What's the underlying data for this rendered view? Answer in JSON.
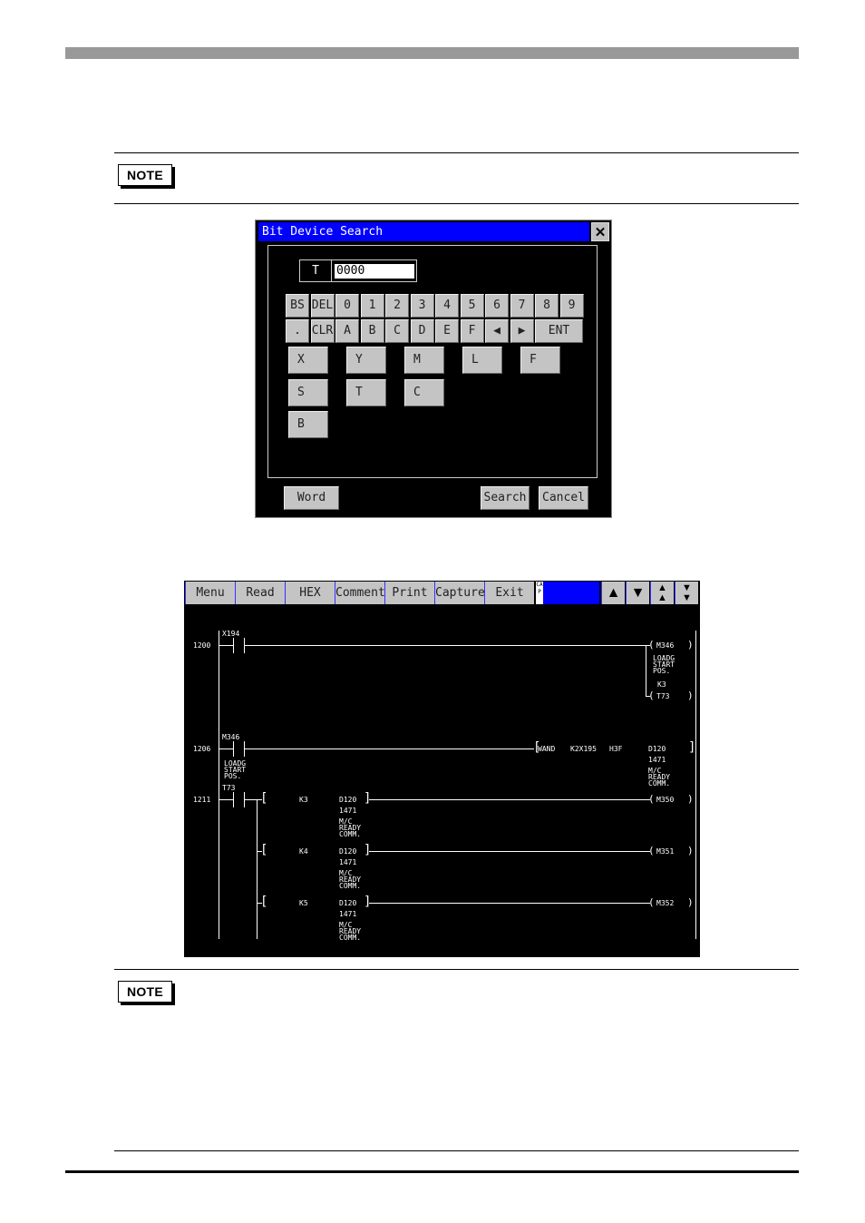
{
  "page": {
    "note_label_1": "NOTE",
    "note_label_2": "NOTE"
  },
  "dialog": {
    "title": "Bit Device Search",
    "close_icon": "close-icon",
    "device_type": "T",
    "device_value": "0000",
    "keypad_row1": [
      "BS",
      "DEL",
      "0",
      "1",
      "2",
      "3",
      "4",
      "5",
      "6",
      "7",
      "8",
      "9"
    ],
    "keypad_row2": [
      ".",
      "CLR",
      "A",
      "B",
      "C",
      "D",
      "E",
      "F",
      "◀",
      "▶",
      "ENT"
    ],
    "device_keys": [
      "X",
      "Y",
      "M",
      "L",
      "F",
      "S",
      "T",
      "C",
      "B"
    ],
    "word_button": "Word",
    "search_button": "Search",
    "cancel_button": "Cancel",
    "colors": {
      "title_bar": "#0000ff",
      "key": "#c4c4c4"
    }
  },
  "ladder": {
    "toolbar": [
      "Menu",
      "Read",
      "HEX",
      "Comment",
      "Print",
      "Capture",
      "Exit"
    ],
    "cap_label": "CAP",
    "nav_icons": [
      "arrow-up-icon",
      "arrow-down-icon",
      "page-up-icon",
      "page-down-icon"
    ],
    "rungs": [
      {
        "step": "1200",
        "contact": "X194",
        "coils": [
          {
            "device": "M346",
            "comment": [
              "LOADG",
              "START",
              "POS."
            ]
          },
          {
            "device": "T73",
            "setting": "K3"
          }
        ]
      },
      {
        "step": "1206",
        "contact": "M346",
        "contact_comment": [
          "LOADG",
          "START",
          "POS."
        ],
        "instruction": {
          "op": "WAND",
          "s1": "K2X195",
          "s2": "H3F",
          "d": "D120",
          "d_value": "1471",
          "d_comment": [
            "M/C",
            "READY",
            "COMM."
          ]
        }
      },
      {
        "step": "1211",
        "contact": "T73",
        "branches": [
          {
            "compare": "K3",
            "device": "D120",
            "value": "1471",
            "comment": [
              "M/C",
              "READY",
              "COMM."
            ],
            "coil": "M350"
          },
          {
            "compare": "K4",
            "device": "D120",
            "value": "1471",
            "comment": [
              "M/C",
              "READY",
              "COMM."
            ],
            "coil": "M351"
          },
          {
            "compare": "K5",
            "device": "D120",
            "value": "1471",
            "comment": [
              "M/C",
              "READY",
              "COMM."
            ],
            "coil": "M352"
          }
        ]
      }
    ]
  }
}
